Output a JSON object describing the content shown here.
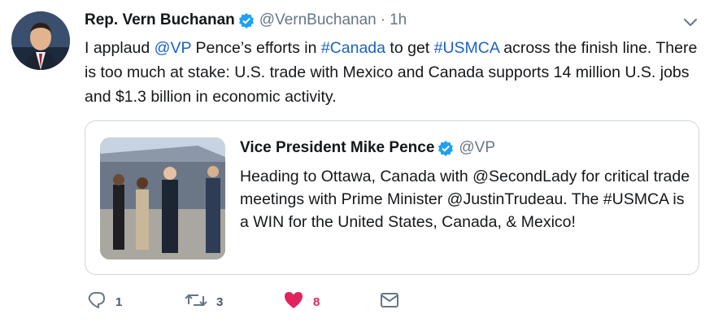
{
  "author": {
    "name": "Rep. Vern Buchanan",
    "handle": "@VernBuchanan",
    "separator": "·",
    "time": "1h"
  },
  "tweet": {
    "t1": "I applaud ",
    "mention_vp": "@VP",
    "t2": " Pence’s efforts in ",
    "hashtag_canada": "#Canada",
    "t3": " to get ",
    "hashtag_usmca": "#USMCA",
    "t4": " across the finish line. There is too much at stake: U.S. trade with Mexico and Canada supports 14 million U.S. jobs and $1.3 billion in economic activity."
  },
  "quoted": {
    "name": "Vice President Mike Pence",
    "handle": "@VP",
    "text": "Heading to Ottawa, Canada with @SecondLady for critical trade meetings with Prime Minister @JustinTrudeau. The #USMCA is a WIN for the United States, Canada, & Mexico!"
  },
  "actions": {
    "reply_count": "1",
    "retweet_count": "3",
    "like_count": "8"
  },
  "colors": {
    "link": "#1b62c4",
    "verified": "#1da1f2",
    "like": "#e0245e",
    "muted": "#657786"
  },
  "icons": [
    "verified-badge-icon",
    "chevron-down-icon",
    "reply-icon",
    "retweet-icon",
    "like-icon",
    "message-icon"
  ]
}
